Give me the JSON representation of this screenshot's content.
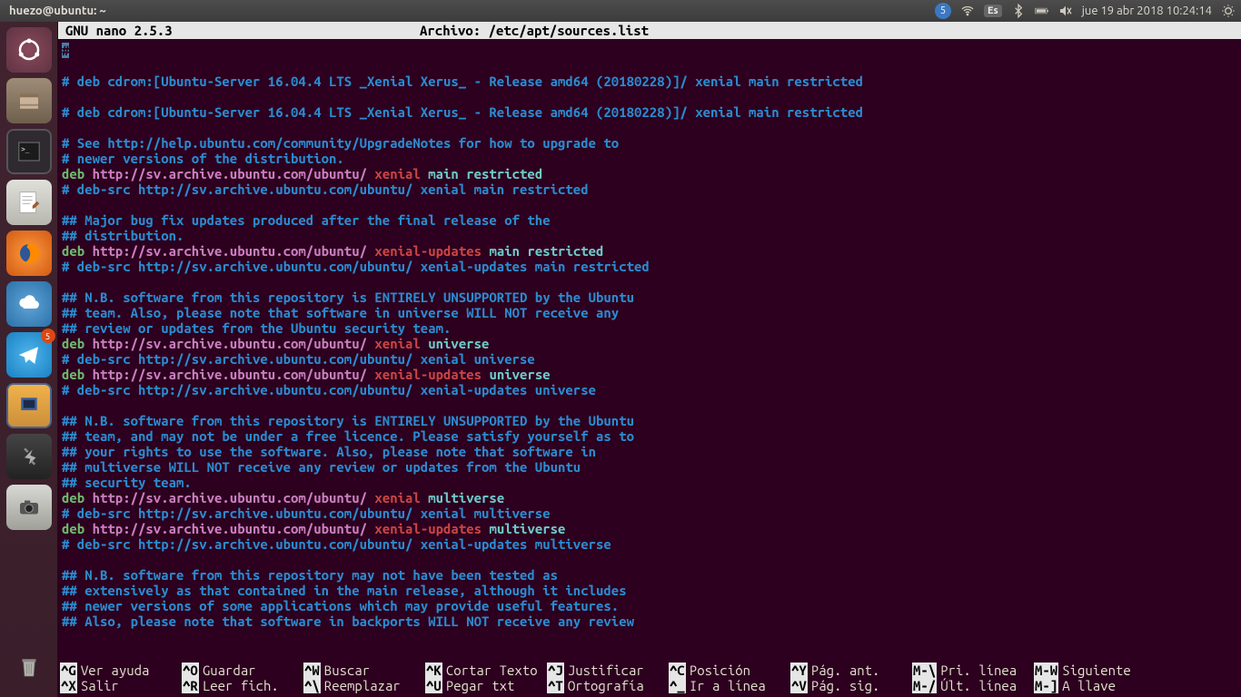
{
  "topbar": {
    "window_title": "huezo@ubuntu: ~",
    "indicators": {
      "notification_count": "5",
      "lang": "Es",
      "datetime": "jue 19 abr 2018 10:24:14"
    }
  },
  "launcher": {
    "telegram_badge": "5"
  },
  "nano": {
    "app": "GNU nano 2.5.3",
    "file_label": "Archivo: /etc/apt/sources.list",
    "lines": [
      {
        "type": "hash",
        "text": "#"
      },
      {
        "type": "blank"
      },
      {
        "type": "comment",
        "text": "# deb cdrom:[Ubuntu-Server 16.04.4 LTS _Xenial Xerus_ - Release amd64 (20180228)]/ xenial main restricted"
      },
      {
        "type": "blank"
      },
      {
        "type": "comment",
        "text": "# deb cdrom:[Ubuntu-Server 16.04.4 LTS _Xenial Xerus_ - Release amd64 (20180228)]/ xenial main restricted"
      },
      {
        "type": "blank"
      },
      {
        "type": "comment",
        "text": "# See http://help.ubuntu.com/community/UpgradeNotes for how to upgrade to"
      },
      {
        "type": "comment",
        "text": "# newer versions of the distribution."
      },
      {
        "type": "deb",
        "url": "http://sv.archive.ubuntu.com/ubuntu/",
        "dist": "xenial",
        "comp": "main restricted"
      },
      {
        "type": "comment",
        "text": "# deb-src http://sv.archive.ubuntu.com/ubuntu/ xenial main restricted"
      },
      {
        "type": "blank"
      },
      {
        "type": "comment",
        "text": "## Major bug fix updates produced after the final release of the"
      },
      {
        "type": "comment",
        "text": "## distribution."
      },
      {
        "type": "deb",
        "url": "http://sv.archive.ubuntu.com/ubuntu/",
        "dist": "xenial-updates",
        "comp": "main restricted"
      },
      {
        "type": "comment",
        "text": "# deb-src http://sv.archive.ubuntu.com/ubuntu/ xenial-updates main restricted"
      },
      {
        "type": "blank"
      },
      {
        "type": "comment",
        "text": "## N.B. software from this repository is ENTIRELY UNSUPPORTED by the Ubuntu"
      },
      {
        "type": "comment",
        "text": "## team. Also, please note that software in universe WILL NOT receive any"
      },
      {
        "type": "comment",
        "text": "## review or updates from the Ubuntu security team."
      },
      {
        "type": "deb",
        "url": "http://sv.archive.ubuntu.com/ubuntu/",
        "dist": "xenial",
        "comp": "universe"
      },
      {
        "type": "comment",
        "text": "# deb-src http://sv.archive.ubuntu.com/ubuntu/ xenial universe"
      },
      {
        "type": "deb",
        "url": "http://sv.archive.ubuntu.com/ubuntu/",
        "dist": "xenial-updates",
        "comp": "universe"
      },
      {
        "type": "comment",
        "text": "# deb-src http://sv.archive.ubuntu.com/ubuntu/ xenial-updates universe"
      },
      {
        "type": "blank"
      },
      {
        "type": "comment",
        "text": "## N.B. software from this repository is ENTIRELY UNSUPPORTED by the Ubuntu"
      },
      {
        "type": "comment",
        "text": "## team, and may not be under a free licence. Please satisfy yourself as to"
      },
      {
        "type": "comment",
        "text": "## your rights to use the software. Also, please note that software in"
      },
      {
        "type": "comment",
        "text": "## multiverse WILL NOT receive any review or updates from the Ubuntu"
      },
      {
        "type": "comment",
        "text": "## security team."
      },
      {
        "type": "deb",
        "url": "http://sv.archive.ubuntu.com/ubuntu/",
        "dist": "xenial",
        "comp": "multiverse"
      },
      {
        "type": "comment",
        "text": "# deb-src http://sv.archive.ubuntu.com/ubuntu/ xenial multiverse"
      },
      {
        "type": "deb",
        "url": "http://sv.archive.ubuntu.com/ubuntu/",
        "dist": "xenial-updates",
        "comp": "multiverse"
      },
      {
        "type": "comment",
        "text": "# deb-src http://sv.archive.ubuntu.com/ubuntu/ xenial-updates multiverse"
      },
      {
        "type": "blank"
      },
      {
        "type": "comment",
        "text": "## N.B. software from this repository may not have been tested as"
      },
      {
        "type": "comment",
        "text": "## extensively as that contained in the main release, although it includes"
      },
      {
        "type": "comment",
        "text": "## newer versions of some applications which may provide useful features."
      },
      {
        "type": "comment",
        "text": "## Also, please note that software in backports WILL NOT receive any review"
      }
    ],
    "shortcuts": [
      [
        {
          "key": "^G",
          "label": "Ver ayuda"
        },
        {
          "key": "^O",
          "label": "Guardar"
        },
        {
          "key": "^W",
          "label": "Buscar"
        },
        {
          "key": "^K",
          "label": "Cortar Texto"
        },
        {
          "key": "^J",
          "label": "Justificar"
        },
        {
          "key": "^C",
          "label": "Posición"
        },
        {
          "key": "^Y",
          "label": "Pág. ant."
        },
        {
          "key": "M-\\",
          "label": "Pri. línea"
        },
        {
          "key": "M-W",
          "label": "Siguiente"
        }
      ],
      [
        {
          "key": "^X",
          "label": "Salir"
        },
        {
          "key": "^R",
          "label": "Leer fich."
        },
        {
          "key": "^\\",
          "label": "Reemplazar"
        },
        {
          "key": "^U",
          "label": "Pegar txt"
        },
        {
          "key": "^T",
          "label": "Ortografía"
        },
        {
          "key": "^_",
          "label": "Ir a línea"
        },
        {
          "key": "^V",
          "label": "Pág. sig."
        },
        {
          "key": "M-/",
          "label": "Últ. línea"
        },
        {
          "key": "M-]",
          "label": "A llave"
        }
      ]
    ]
  }
}
